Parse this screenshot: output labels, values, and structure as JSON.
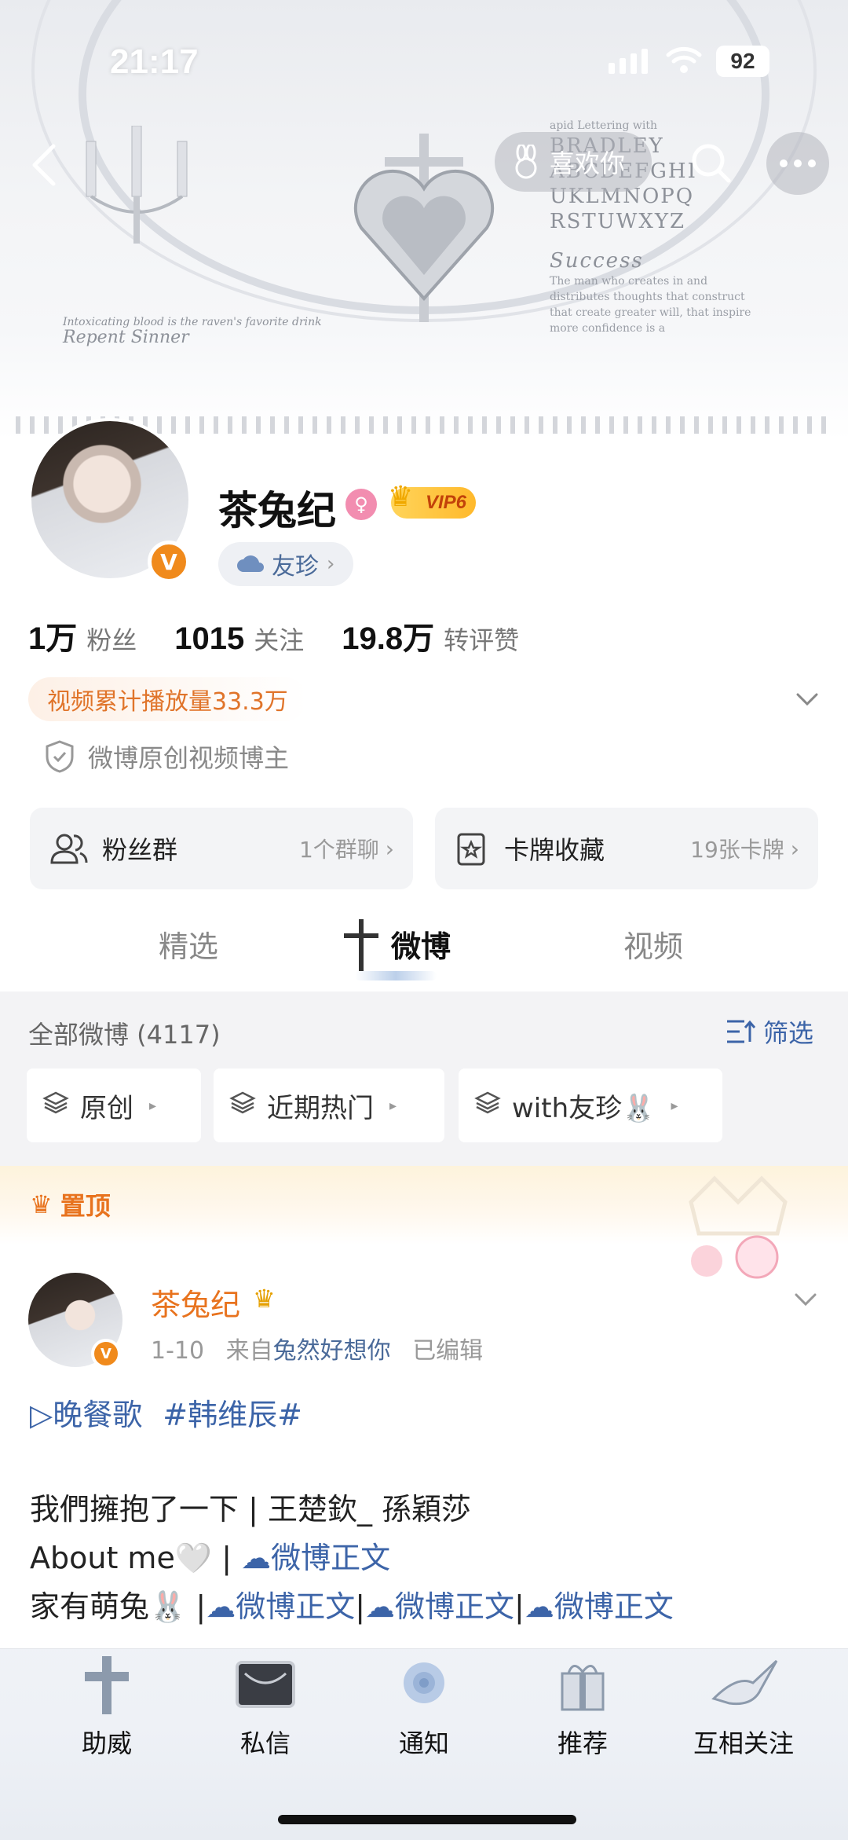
{
  "status_bar": {
    "time": "21:17",
    "battery": "92"
  },
  "cover": {
    "letters_title": "apid Lettering with",
    "letters_sub": "BRADLEY",
    "letters_row1": "ABCDEFGHI",
    "letters_row2": "UKLMNOPQ",
    "letters_row3": "RSTUWXYZ",
    "success": "Success",
    "success_text": "The man who creates in and distributes thoughts that construct that create greater will, that inspire more confidence is a",
    "left_script_1": "Intoxicating blood is the raven's favorite drink",
    "left_script_2": "Repent Sinner"
  },
  "nav": {
    "like_label": "喜欢你"
  },
  "profile": {
    "name": "茶兔纪",
    "vip_label": "VIP6",
    "avatar_badge": "V",
    "friend": "友珍",
    "stats": [
      {
        "num": "1万",
        "label": "粉丝"
      },
      {
        "num": "1015",
        "label": "关注"
      },
      {
        "num": "19.8万",
        "label": "转评赞"
      }
    ],
    "play_count": "视频累计播放量33.3万",
    "cert": "微博原创视频博主"
  },
  "cards": {
    "fans_group": {
      "title": "粉丝群",
      "sub": "1个群聊"
    },
    "card_collection": {
      "title": "卡牌收藏",
      "sub": "19张卡牌"
    }
  },
  "tabs": [
    "精选",
    "微博",
    "视频"
  ],
  "filters": {
    "all_count": "全部微博 (4117)",
    "filter_label": "筛选",
    "chips": [
      "原创",
      "近期热门",
      "with友珍🐰"
    ]
  },
  "pinned": {
    "label": "置顶"
  },
  "post": {
    "author": "茶兔纪",
    "badge": "V",
    "date": "1-10",
    "from_prefix": "来自",
    "source": "兔然好想你",
    "edited": "已编辑",
    "tag1": "▷晚餐歌",
    "tag2": "#韩维辰#",
    "line1": "我們擁抱了一下 | 王楚欽_ 孫穎莎",
    "line2_a": "About me🤍 | ",
    "link": "微博正文",
    "line3_a": "家有萌兔🐰 |",
    "sep": "|"
  },
  "dock": [
    "助威",
    "私信",
    "通知",
    "推荐",
    "互相关注"
  ],
  "colors": {
    "accent_orange": "#e8731e",
    "link_blue": "#3c64a8",
    "vip_gold": "#ffc53d"
  }
}
